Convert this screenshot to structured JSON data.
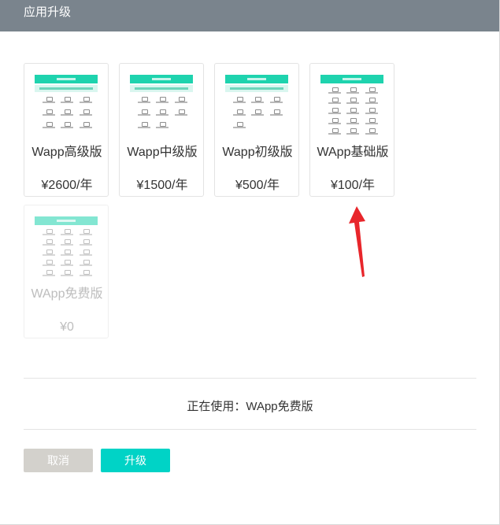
{
  "dialog": {
    "title": "应用升级"
  },
  "plans": [
    {
      "name": "Wapp高级版",
      "price": "¥2600/年"
    },
    {
      "name": "Wapp中级版",
      "price": "¥1500/年"
    },
    {
      "name": "Wapp初级版",
      "price": "¥500/年"
    },
    {
      "name": "WApp基础版",
      "price": "¥100/年"
    },
    {
      "name": "WApp免费版",
      "price": "¥0"
    }
  ],
  "current_plan": {
    "text": "正在使用：WApp免费版"
  },
  "buttons": {
    "cancel": "取消",
    "upgrade": "升级"
  },
  "colors": {
    "accent": "#00d3c6",
    "arrow": "#e8262b",
    "titlebar": "#7a848d"
  }
}
